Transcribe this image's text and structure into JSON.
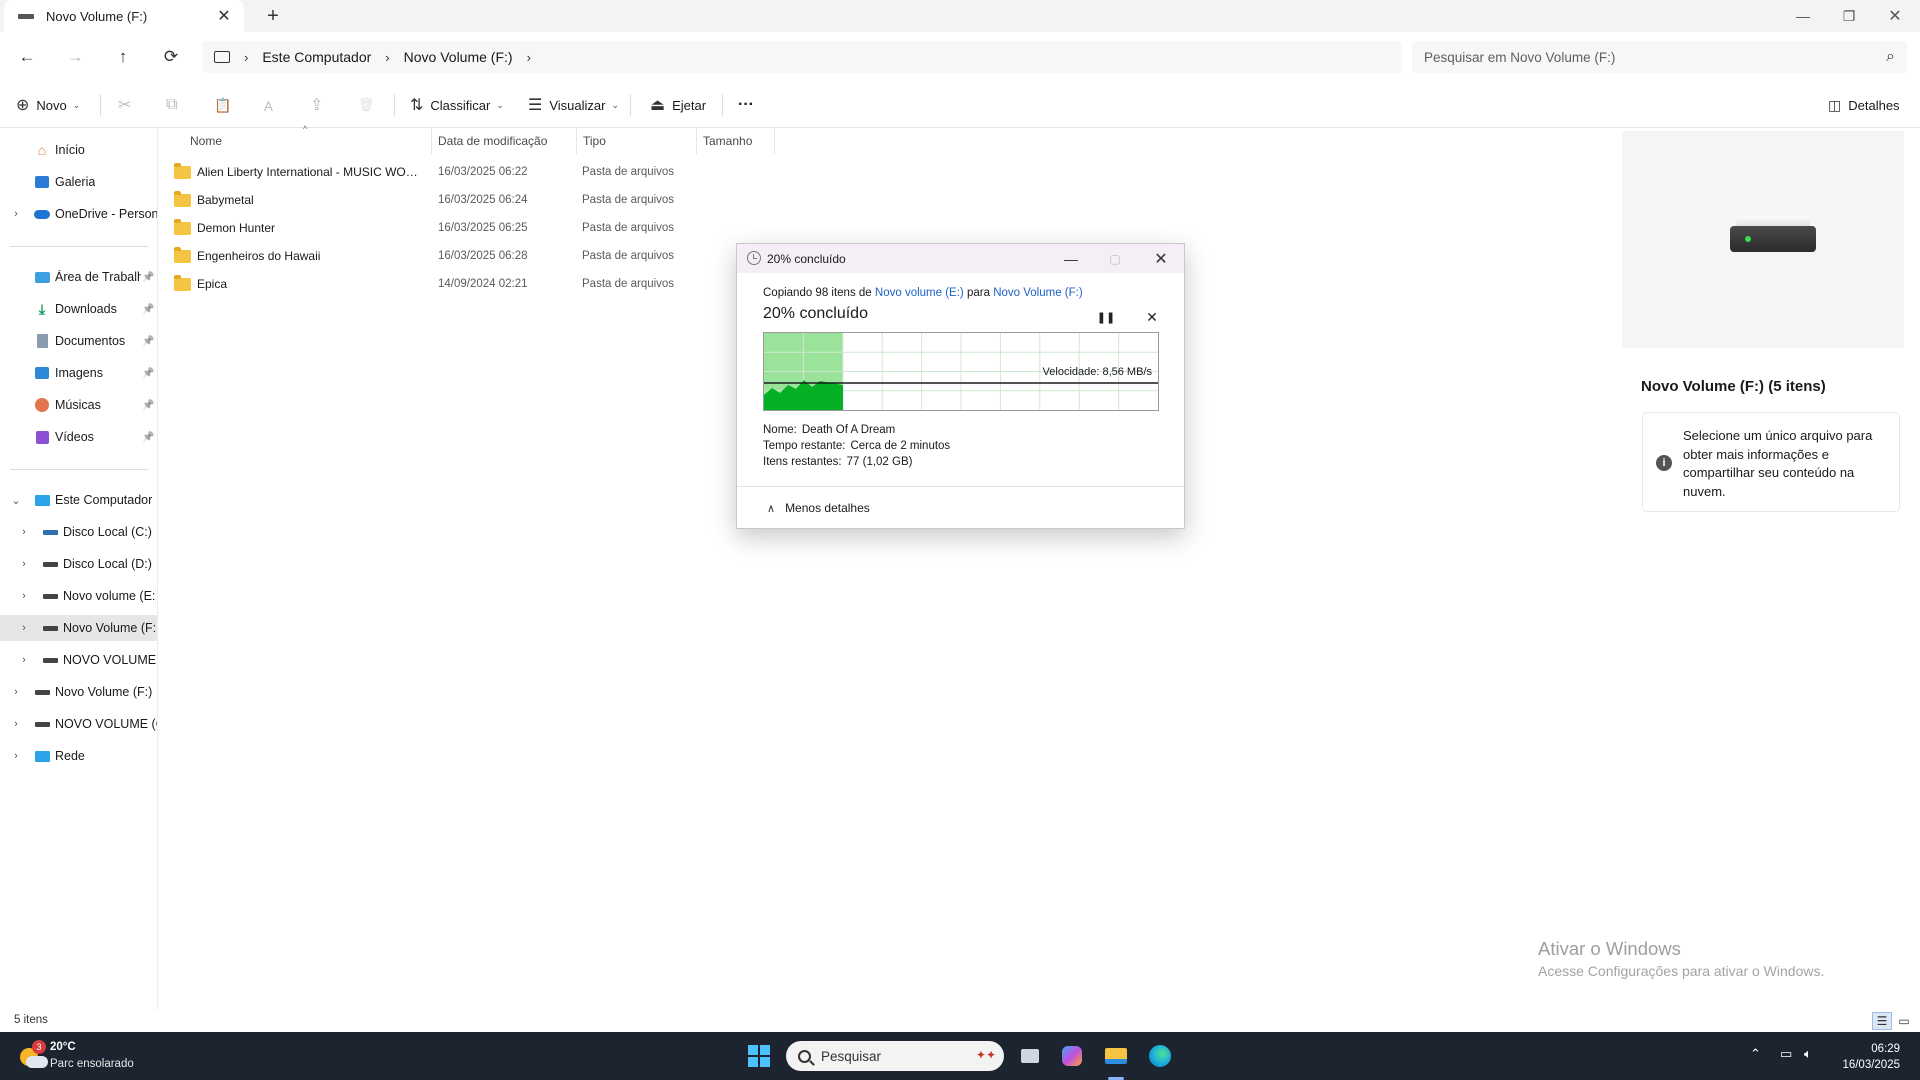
{
  "tab": {
    "title": "Novo Volume (F:)",
    "close": "✕",
    "new": "+"
  },
  "window_controls": {
    "minimize": "—",
    "restore": "❐",
    "close": "✕"
  },
  "nav": {
    "back": "←",
    "forward": "→",
    "up": "↑",
    "refresh": "⟳"
  },
  "breadcrumb": {
    "root": "Este Computador",
    "current": "Novo Volume (F:)",
    "sep": "›"
  },
  "search": {
    "placeholder": "Pesquisar em Novo Volume (F:)",
    "icon": "⌕"
  },
  "toolbar": {
    "new_label": "Novo",
    "sort_label": "Classificar",
    "view_label": "Visualizar",
    "eject_label": "Ejetar",
    "more_label": "···",
    "details_label": "Detalhes",
    "cut_icon": "✂",
    "copy_icon": "⧉",
    "paste_icon": "📋",
    "rename_icon": "Ａ",
    "share_icon": "⇪",
    "delete_icon": "🗑"
  },
  "sidebar": {
    "items": [
      {
        "label": "Início",
        "icon": "home-icon"
      },
      {
        "label": "Galeria",
        "icon": "gallery-icon"
      },
      {
        "label": "OneDrive - Persona",
        "icon": "cloud-icon"
      },
      {
        "label": "Área de Trabalho",
        "icon": "desktop-icon"
      },
      {
        "label": "Downloads",
        "icon": "download-icon"
      },
      {
        "label": "Documentos",
        "icon": "document-icon"
      },
      {
        "label": "Imagens",
        "icon": "image-icon"
      },
      {
        "label": "Músicas",
        "icon": "music-icon"
      },
      {
        "label": "Vídeos",
        "icon": "video-icon"
      },
      {
        "label": "Este Computador",
        "icon": "computer-icon"
      },
      {
        "label": "Disco Local (C:)",
        "icon": "drive-icon"
      },
      {
        "label": "Disco Local (D:)",
        "icon": "drive-icon"
      },
      {
        "label": "Novo volume (E:)",
        "icon": "drive-icon"
      },
      {
        "label": "Novo Volume (F:)",
        "icon": "drive-icon"
      },
      {
        "label": "NOVO VOLUME (G:)",
        "icon": "drive-icon"
      },
      {
        "label": "Novo Volume (F:)",
        "icon": "drive-icon"
      },
      {
        "label": "NOVO VOLUME (G:)",
        "icon": "drive-icon"
      },
      {
        "label": "Rede",
        "icon": "network-icon"
      }
    ],
    "pin": "📌",
    "expand": "›",
    "collapse": "⌄"
  },
  "columns": {
    "name": "Nome",
    "date": "Data de modificação",
    "type": "Tipo",
    "size": "Tamanho"
  },
  "files": [
    {
      "name": "Alien Liberty International - MUSIC WORLD",
      "date": "16/03/2025 06:22",
      "type": "Pasta de arquivos"
    },
    {
      "name": "Babymetal",
      "date": "16/03/2025 06:24",
      "type": "Pasta de arquivos"
    },
    {
      "name": "Demon Hunter",
      "date": "16/03/2025 06:25",
      "type": "Pasta de arquivos"
    },
    {
      "name": "Engenheiros do Hawaii",
      "date": "16/03/2025 06:28",
      "type": "Pasta de arquivos"
    },
    {
      "name": "Epica",
      "date": "14/09/2024 02:21",
      "type": "Pasta de arquivos"
    }
  ],
  "details": {
    "title": "Novo Volume (F:) (5 itens)",
    "info": "Selecione um único arquivo para obter mais informações e compartilhar seu conteúdo na nuvem.",
    "info_icon": "i"
  },
  "watermark": {
    "line1": "Ativar o Windows",
    "line2": "Acesse Configurações para ativar o Windows."
  },
  "status": {
    "count": "5 itens"
  },
  "copy_dialog": {
    "title": "20% concluído",
    "copy_prefix": "Copiando 98 itens de",
    "source": "Novo volume (E:)",
    "to": "para",
    "dest": "Novo Volume (F:)",
    "big_status": "20% concluído",
    "pause": "❚❚",
    "stop": "✕",
    "speed": "Velocidade: 8,56 MB/s",
    "progress_fraction": 0.2,
    "name_label": "Nome:",
    "name_value": "Death Of A Dream",
    "time_label": "Tempo restante:",
    "time_value": "Cerca de 2 minutos",
    "items_label": "Itens restantes:",
    "items_value": "77 (1,02 GB)",
    "less_details": "Menos detalhes",
    "less_icon": "∧",
    "minimize": "—",
    "close": "✕"
  },
  "taskbar": {
    "temp": "20°C",
    "weather": "Parc ensolarado",
    "badge": "3",
    "search": "Pesquisar",
    "time": "06:29",
    "date": "16/03/2025"
  },
  "colors": {
    "accent": "#1c62c7",
    "progress": "#06b025",
    "taskbar": "#1c2430"
  }
}
